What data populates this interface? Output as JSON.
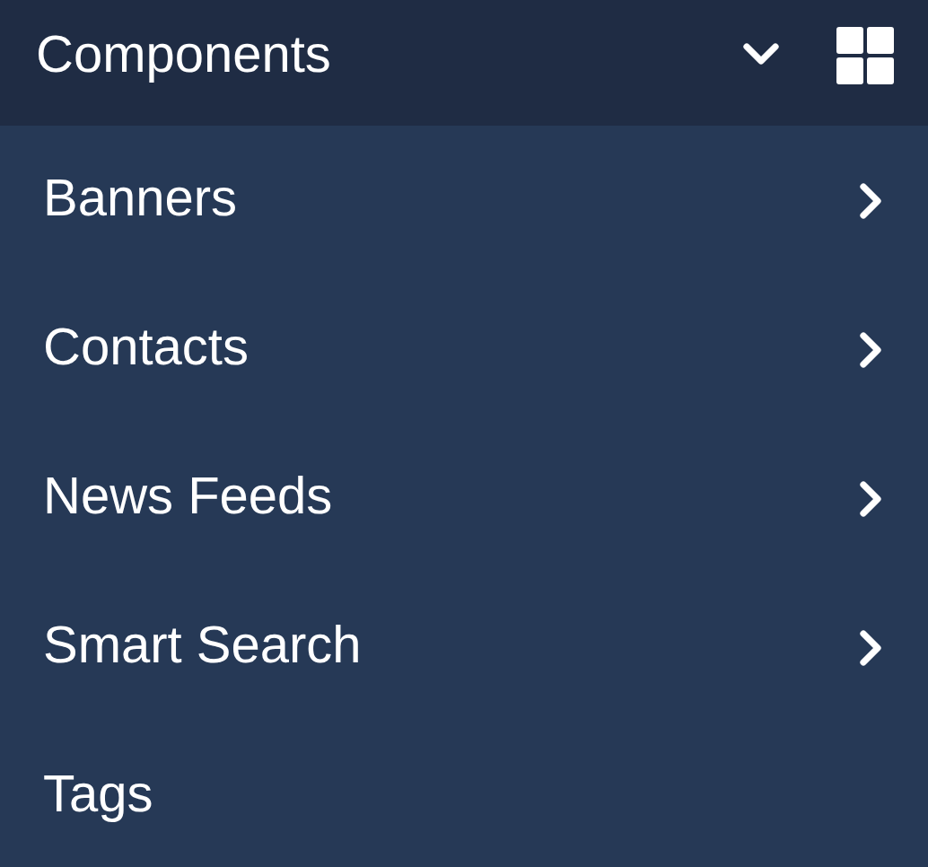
{
  "menu": {
    "title": "Components",
    "expanded": true,
    "items": [
      {
        "label": "Banners",
        "has_children": true
      },
      {
        "label": "Contacts",
        "has_children": true
      },
      {
        "label": "News Feeds",
        "has_children": true
      },
      {
        "label": "Smart Search",
        "has_children": true
      },
      {
        "label": "Tags",
        "has_children": false
      }
    ]
  }
}
